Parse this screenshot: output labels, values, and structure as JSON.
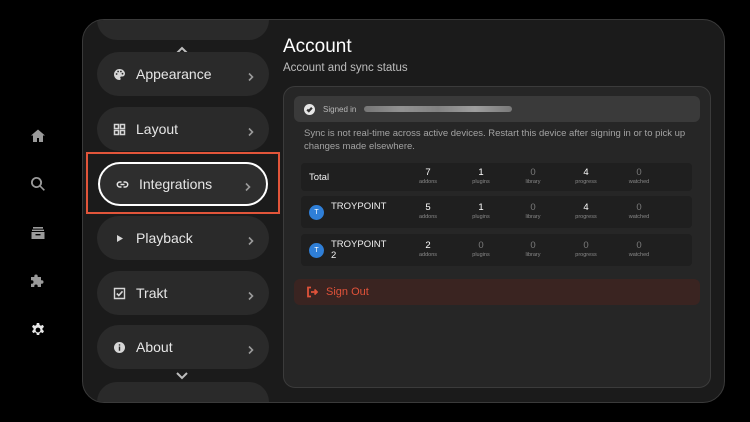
{
  "rail": {
    "items": [
      {
        "icon": "home-icon"
      },
      {
        "icon": "search-icon"
      },
      {
        "icon": "library-icon"
      },
      {
        "icon": "puzzle-icon"
      },
      {
        "icon": "gear-icon",
        "active": true
      }
    ]
  },
  "menu": {
    "items": [
      {
        "label": "Appearance",
        "icon": "palette-icon"
      },
      {
        "label": "Layout",
        "icon": "grid-icon"
      },
      {
        "label": "Integrations",
        "icon": "link-icon",
        "selected": true
      },
      {
        "label": "Playback",
        "icon": "play-icon"
      },
      {
        "label": "Trakt",
        "icon": "checkbox-icon"
      },
      {
        "label": "About",
        "icon": "info-icon"
      }
    ]
  },
  "account": {
    "title": "Account",
    "subtitle": "Account and sync status",
    "signed_in_label": "Signed in",
    "sync_note": "Sync is not real-time across active devices. Restart this device after signing in or to pick up changes made elsewhere.",
    "stat_labels": [
      "addons",
      "plugins",
      "library",
      "progress",
      "watched"
    ],
    "rows": [
      {
        "name": "Total",
        "values": [
          "7",
          "1",
          "0",
          "4",
          "0"
        ]
      },
      {
        "name": "TROYPOINT",
        "avatar": "T",
        "values": [
          "5",
          "1",
          "0",
          "4",
          "0"
        ]
      },
      {
        "name": "TROYPOINT 2",
        "avatar": "T",
        "values": [
          "2",
          "0",
          "0",
          "0",
          "0"
        ]
      }
    ],
    "sign_out_label": "Sign Out"
  },
  "colors": {
    "accent_focus": "#e2553a",
    "sign_out": "#e0523a",
    "avatar": "#2f7fd8"
  }
}
